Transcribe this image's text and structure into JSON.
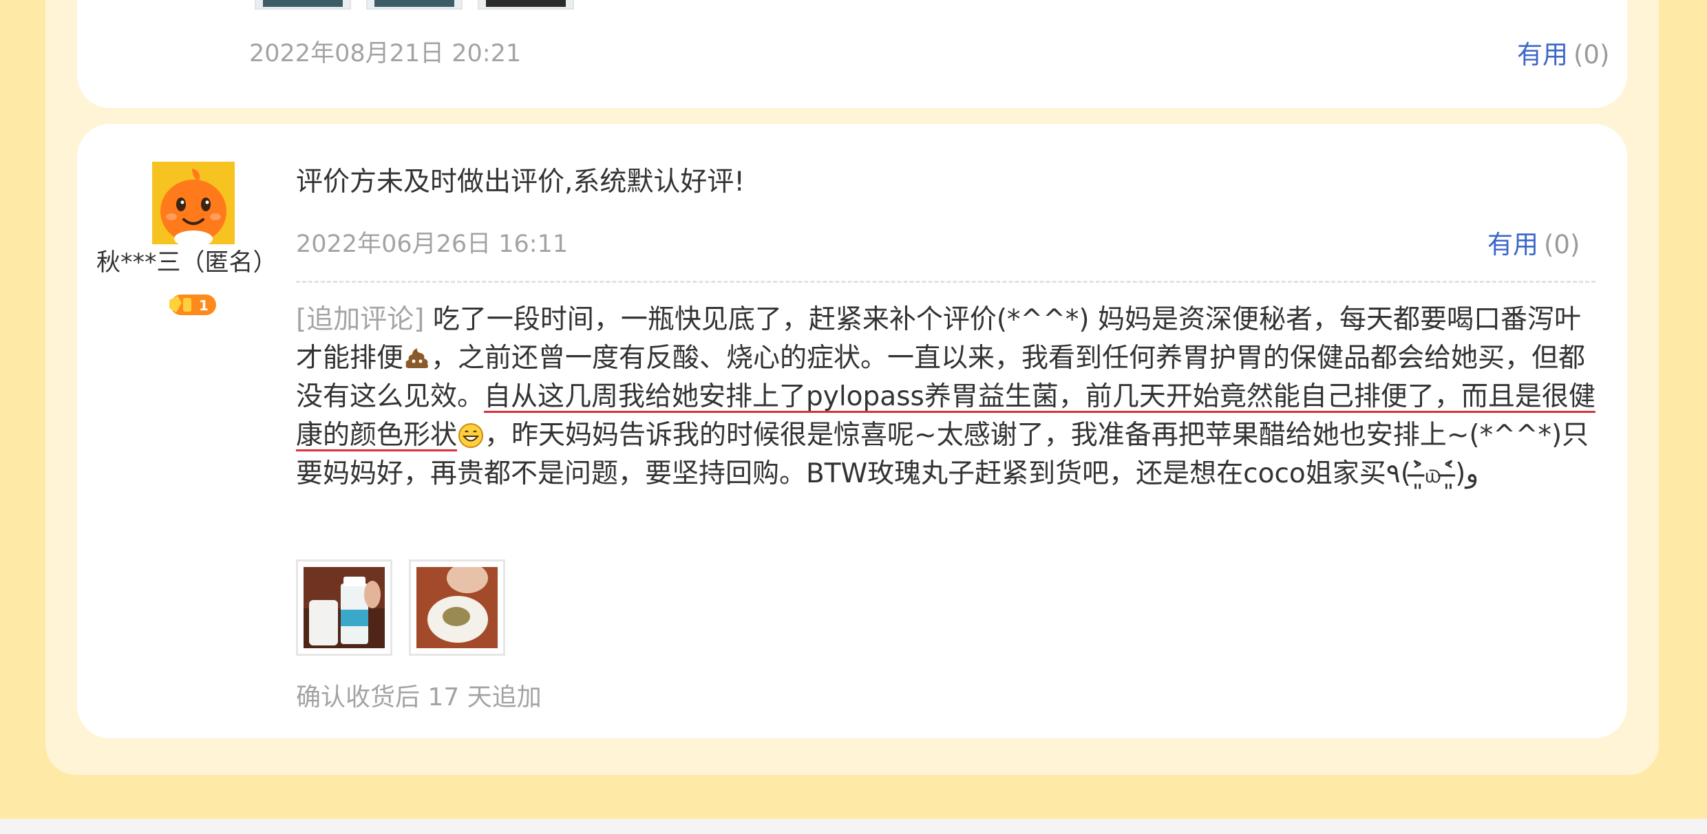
{
  "previous_review": {
    "date": "2022年08月21日 20:21",
    "useful_label": "有用",
    "useful_count": "(0)"
  },
  "review": {
    "username": "秋***三（匿名）",
    "level_badge": "1",
    "default_text": "评价方未及时做出评价,系统默认好评!",
    "date": "2022年06月26日 16:11",
    "useful_label": "有用",
    "useful_count": "(0)",
    "append_tag": "[追加评论]",
    "append_text_1": " 吃了一段时间，一瓶快见底了，赶紧来补个评价(*^^*) 妈妈是资深便秘者，每天都要喝口番泻叶才能排便",
    "append_text_2": "，之前还曾一度有反酸、烧心的症状。一直以来，我看到任何养胃护胃的保健品都会给她买，但都没有这么见效。",
    "append_highlight": "自从这几周我给她安排上了pylopass养胃益生菌，前几天开始竟然能自己排便了，而且是很健康的颜色形状",
    "append_text_3": "，昨天妈妈告诉我的时候很是惊喜呢~太感谢了，我准备再把苹果醋给她也安排上~(*^^*)只要妈妈好，再贵都不是问题，要坚持回购。BTW玫瑰丸子赶紧到货吧，还是想在coco姐家买٩(˃̶͈̀௰˂̶͈́)و",
    "append_note": "确认收货后 17 天追加",
    "icons": [
      "avatar-mascot",
      "poop-emoji",
      "grin-emoji",
      "level-badge"
    ]
  },
  "colors": {
    "background": "#ffe9a6",
    "panel": "#fff4d6",
    "link": "#3a67c9",
    "underline": "#d9323c"
  }
}
